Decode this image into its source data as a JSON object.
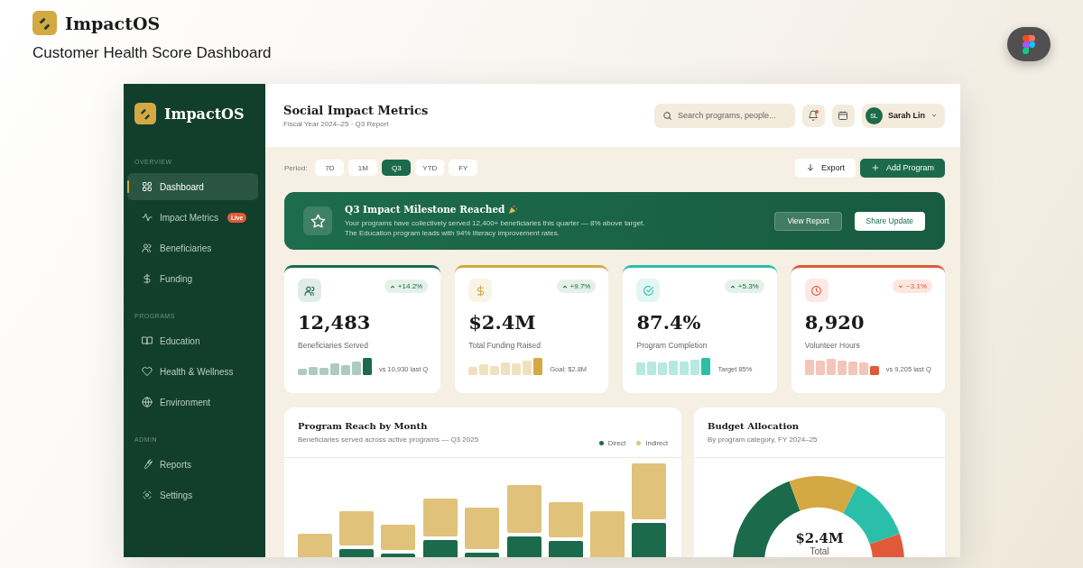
{
  "brand": {
    "name": "ImpactOS",
    "subtitle": "Customer Health Score Dashboard"
  },
  "sidebar": {
    "brand": "ImpactOS",
    "sections": [
      {
        "title": "OVERVIEW",
        "items": [
          {
            "kind": "grid",
            "label": "Dashboard",
            "selected": true
          },
          {
            "kind": "activity",
            "label": "Impact Metrics",
            "badge": "Live",
            "selected": false
          },
          {
            "kind": "users",
            "label": "Beneficiaries",
            "selected": false
          },
          {
            "kind": "dollar",
            "label": "Funding",
            "selected": false
          }
        ]
      },
      {
        "title": "PROGRAMS",
        "items": [
          {
            "kind": "book",
            "label": "Education",
            "selected": false
          },
          {
            "kind": "heart",
            "label": "Health & Wellness",
            "selected": false
          },
          {
            "kind": "globe",
            "label": "Environment",
            "selected": false
          }
        ]
      },
      {
        "title": "ADMIN",
        "items": [
          {
            "kind": "wrench",
            "label": "Reports",
            "selected": false
          },
          {
            "kind": "settings",
            "label": "Settings",
            "selected": false
          }
        ]
      }
    ]
  },
  "header": {
    "title": "Social Impact Metrics",
    "subtitle": "Fiscal Year 2024–25 · Q3 Report",
    "search": {
      "placeholder": "Search programs, people..."
    },
    "notifications_unread": true,
    "user": {
      "initials": "SL",
      "name": "Sarah Lin"
    }
  },
  "period": {
    "label": "Period:",
    "options": [
      {
        "label": "7D",
        "selected": false
      },
      {
        "label": "1M",
        "selected": false
      },
      {
        "label": "Q3",
        "selected": true
      },
      {
        "label": "YTD",
        "selected": false
      },
      {
        "label": "FY",
        "selected": false
      }
    ]
  },
  "actions": [
    {
      "kind": "export",
      "label": "Export"
    },
    {
      "kind": "add",
      "label": "Add Program"
    }
  ],
  "banner": {
    "title": "Q3 Impact Milestone Reached",
    "lines": [
      "Your programs have collectively served 12,400+ beneficiaries this quarter — 8% above target.",
      "The Education program leads with 94% literacy improvement rates."
    ],
    "buttons": [
      {
        "kind": "secondary",
        "label": "View Report"
      },
      {
        "kind": "primary",
        "label": "Share Update"
      }
    ]
  },
  "stats": [
    {
      "color": "#1b6a4c",
      "kind": "up",
      "change": "+14.2%",
      "value": "12,483",
      "label": "Beneficiaries Served",
      "caption": "vs 10,930 last Q"
    },
    {
      "color": "#d4a944",
      "kind": "up",
      "change": "+9.7%",
      "value": "$2.4M",
      "label": "Total Funding Raised",
      "caption": "Goal: $2.8M"
    },
    {
      "color": "#2bbfaa",
      "kind": "up",
      "change": "+5.3%",
      "value": "87.4%",
      "label": "Program Completion",
      "caption": "Target 85%"
    },
    {
      "color": "#e05a3a",
      "kind": "down",
      "change": "−3.1%",
      "value": "8,920",
      "label": "Volunteer Hours",
      "caption": "vs 9,205 last Q"
    }
  ],
  "reach": {
    "title": "Program Reach by Month",
    "subtitle": "Beneficiaries served across active programs — Q3 2025",
    "legend": [
      {
        "label": "Direct",
        "color": "#1b6a4c"
      },
      {
        "label": "Indirect",
        "color": "#e0c27a"
      }
    ]
  },
  "budget": {
    "title": "Budget Allocation",
    "subtitle": "By program category, FY 2024–25",
    "total": "$2.4M",
    "total_label": "Total"
  }
}
